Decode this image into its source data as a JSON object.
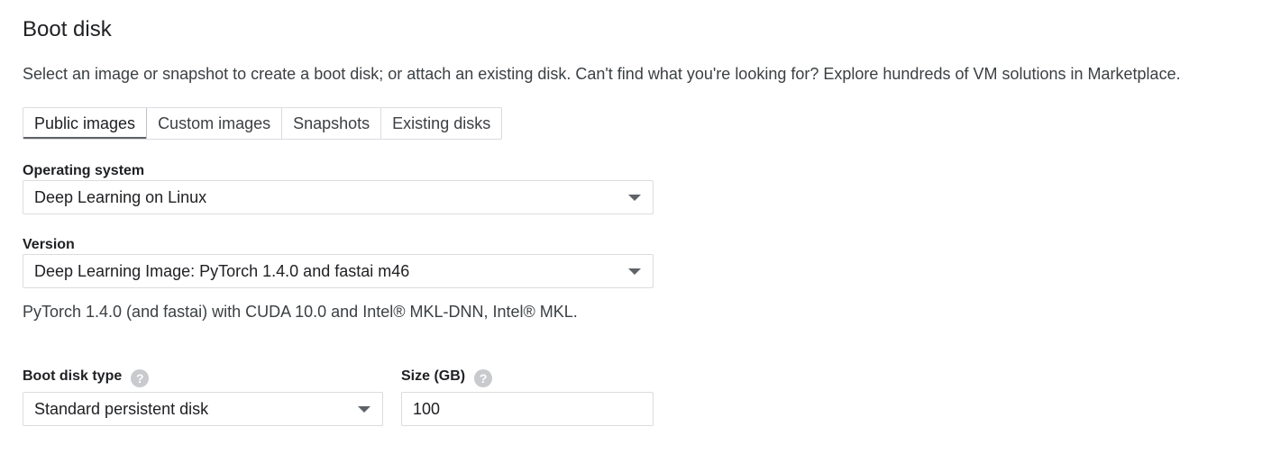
{
  "section": {
    "title": "Boot disk",
    "description": "Select an image or snapshot to create a boot disk; or attach an existing disk. Can't find what you're looking for? Explore hundreds of VM solutions in ",
    "marketplace_link": "Marketplace."
  },
  "tabs": [
    {
      "label": "Public images",
      "active": true
    },
    {
      "label": "Custom images",
      "active": false
    },
    {
      "label": "Snapshots",
      "active": false
    },
    {
      "label": "Existing disks",
      "active": false
    }
  ],
  "operating_system": {
    "label": "Operating system",
    "value": "Deep Learning on Linux"
  },
  "version": {
    "label": "Version",
    "value": "Deep Learning Image: PyTorch 1.4.0 and fastai m46",
    "description": "PyTorch 1.4.0 (and fastai) with CUDA 10.0 and Intel® MKL-DNN, Intel® MKL."
  },
  "boot_disk_type": {
    "label": "Boot disk type",
    "help_icon": "help-icon",
    "value": "Standard persistent disk"
  },
  "size": {
    "label": "Size (GB)",
    "help_icon": "help-icon",
    "value": "100"
  }
}
